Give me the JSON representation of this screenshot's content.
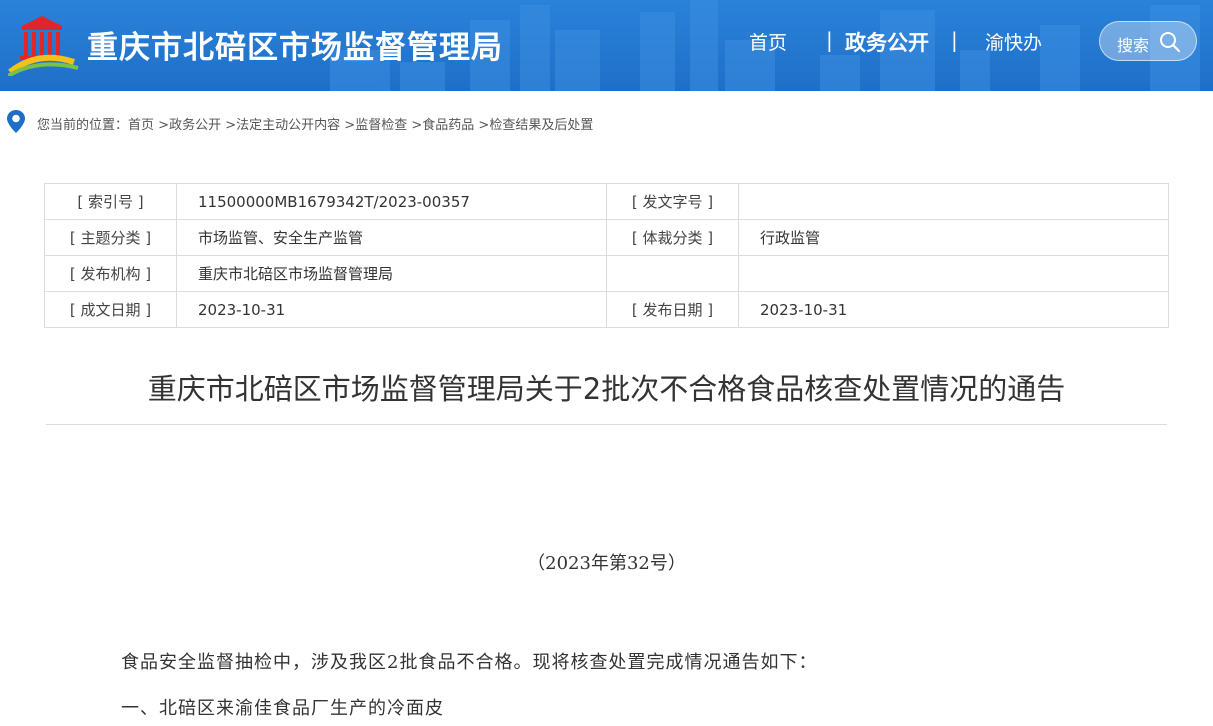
{
  "header": {
    "site_title": "重庆市北碚区市场监督管理局",
    "nav": {
      "home": "首页",
      "separator": "|",
      "gov_affairs": "政务公开",
      "yu_kuai_ban": "渝快办"
    },
    "search_label": "搜索"
  },
  "breadcrumb": {
    "prefix": "您当前的位置：",
    "items": [
      "首页",
      "政务公开",
      "法定主动公开内容",
      "监督检查",
      "食品药品",
      "检查结果及后处置"
    ],
    "separator": ">"
  },
  "meta": {
    "index_no_label": "[ 索引号 ]",
    "index_no_value": "11500000MB1679342T/2023-00357",
    "doc_no_label": "[ 发文字号 ]",
    "doc_no_value": "",
    "subject_label": "[ 主题分类 ]",
    "subject_value": "市场监管、安全生产监管",
    "genre_label": "[ 体裁分类 ]",
    "genre_value": "行政监管",
    "issuer_label": "[ 发布机构 ]",
    "issuer_value": "重庆市北碚区市场监督管理局",
    "created_label": "[ 成文日期 ]",
    "created_value": "2023-10-31",
    "published_label": "[ 发布日期 ]",
    "published_value": "2023-10-31"
  },
  "article": {
    "title": "重庆市北碚区市场监督管理局关于2批次不合格食品核查处置情况的通告",
    "doc_number": "（2023年第32号）",
    "paragraphs": [
      "食品安全监督抽检中，涉及我区2批食品不合格。现将核查处置完成情况通告如下：",
      "一、北碚区来渝佳食品厂生产的冷面皮"
    ]
  },
  "colors": {
    "header_blue": "#2a82d9",
    "text": "#333333",
    "border": "#dcdcdc"
  }
}
